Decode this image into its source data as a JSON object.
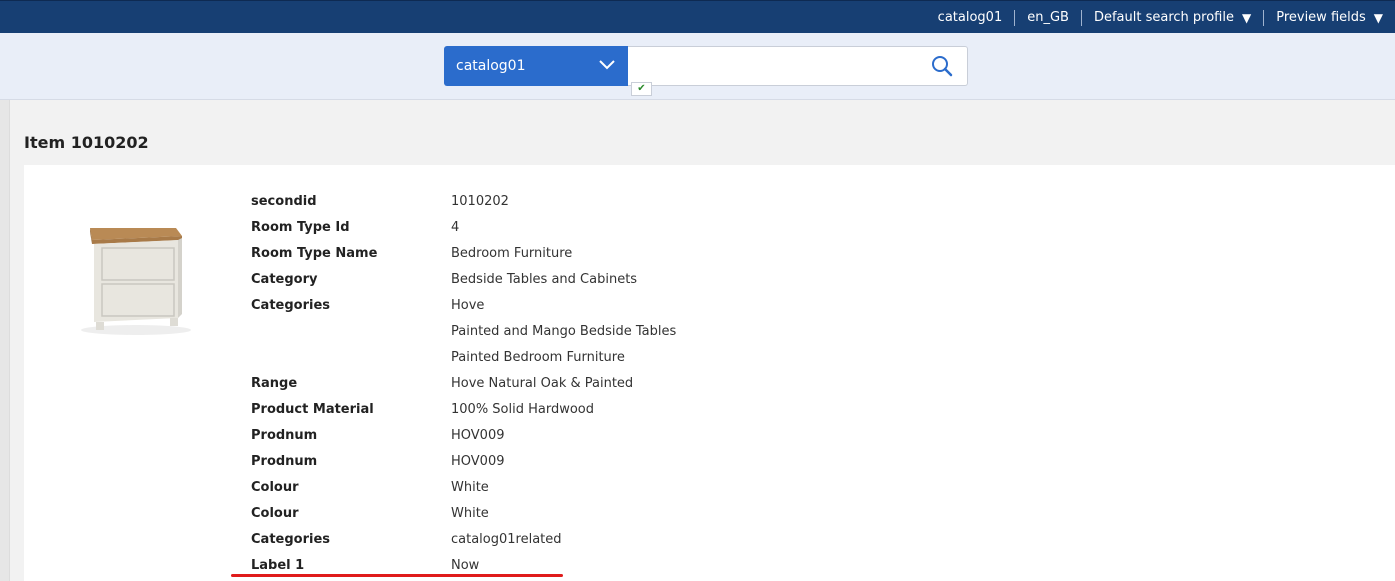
{
  "topbar": {
    "catalog": "catalog01",
    "locale": "en_GB",
    "search_profile": "Default search profile",
    "preview_fields": "Preview fields"
  },
  "search": {
    "catalog_selected": "catalog01",
    "query_value": "",
    "placeholder": ""
  },
  "item": {
    "title": "Item 1010202",
    "image_icon": "bedside-cabinet-image",
    "fields": [
      {
        "label": "secondid",
        "value": "1010202"
      },
      {
        "label": "Room Type Id",
        "value": "4"
      },
      {
        "label": "Room Type Name",
        "value": "Bedroom Furniture"
      },
      {
        "label": "Category",
        "value": "Bedside Tables and Cabinets"
      },
      {
        "label": "Categories",
        "value": "Hove"
      },
      {
        "label": "",
        "value": "Painted and Mango Bedside Tables"
      },
      {
        "label": "",
        "value": "Painted Bedroom Furniture"
      },
      {
        "label": "Range",
        "value": "Hove Natural Oak & Painted"
      },
      {
        "label": "Product Material",
        "value": "100% Solid Hardwood"
      },
      {
        "label": "Prodnum",
        "value": "HOV009"
      },
      {
        "label": "Prodnum",
        "value": "HOV009"
      },
      {
        "label": "Colour",
        "value": "White"
      },
      {
        "label": "Colour",
        "value": "White"
      },
      {
        "label": "Categories",
        "value": "catalog01related"
      },
      {
        "label": "Label 1",
        "value": "Now"
      }
    ]
  },
  "colors": {
    "topbar_bg": "#173f73",
    "accent_blue": "#2b6ccc",
    "highlight_red": "#e01b1b"
  }
}
